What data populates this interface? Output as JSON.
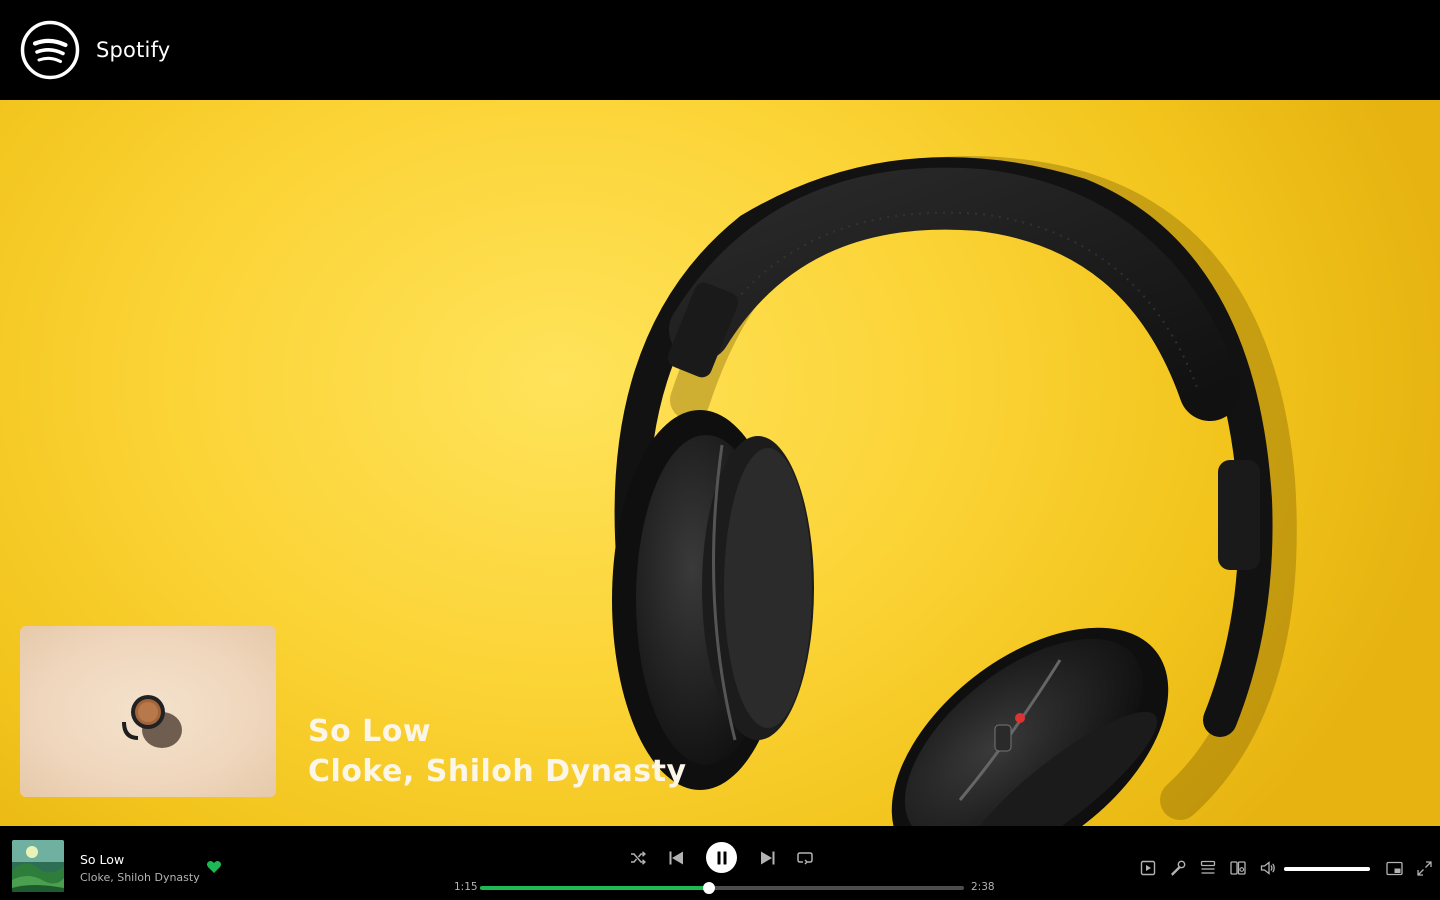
{
  "app": {
    "name": "Spotify"
  },
  "now_playing": {
    "title": "So Low",
    "artists": "Cloke, Shiloh Dynasty",
    "liked": true
  },
  "player": {
    "elapsed": "1:15",
    "duration": "2:38",
    "progress_fraction": 0.474,
    "volume_fraction": 1.0,
    "accent_color": "#1db954",
    "state": "playing"
  },
  "icons": {
    "logo": "spotify-logo",
    "shuffle": "shuffle-icon",
    "previous": "skip-previous-icon",
    "pause": "pause-icon",
    "next": "skip-next-icon",
    "repeat": "repeat-icon",
    "now_playing_view": "now-playing-view-icon",
    "lyrics": "microphone-icon",
    "queue": "queue-icon",
    "devices": "connect-device-icon",
    "volume": "volume-icon",
    "miniplayer": "miniplayer-icon",
    "fullscreen": "fullscreen-icon"
  }
}
